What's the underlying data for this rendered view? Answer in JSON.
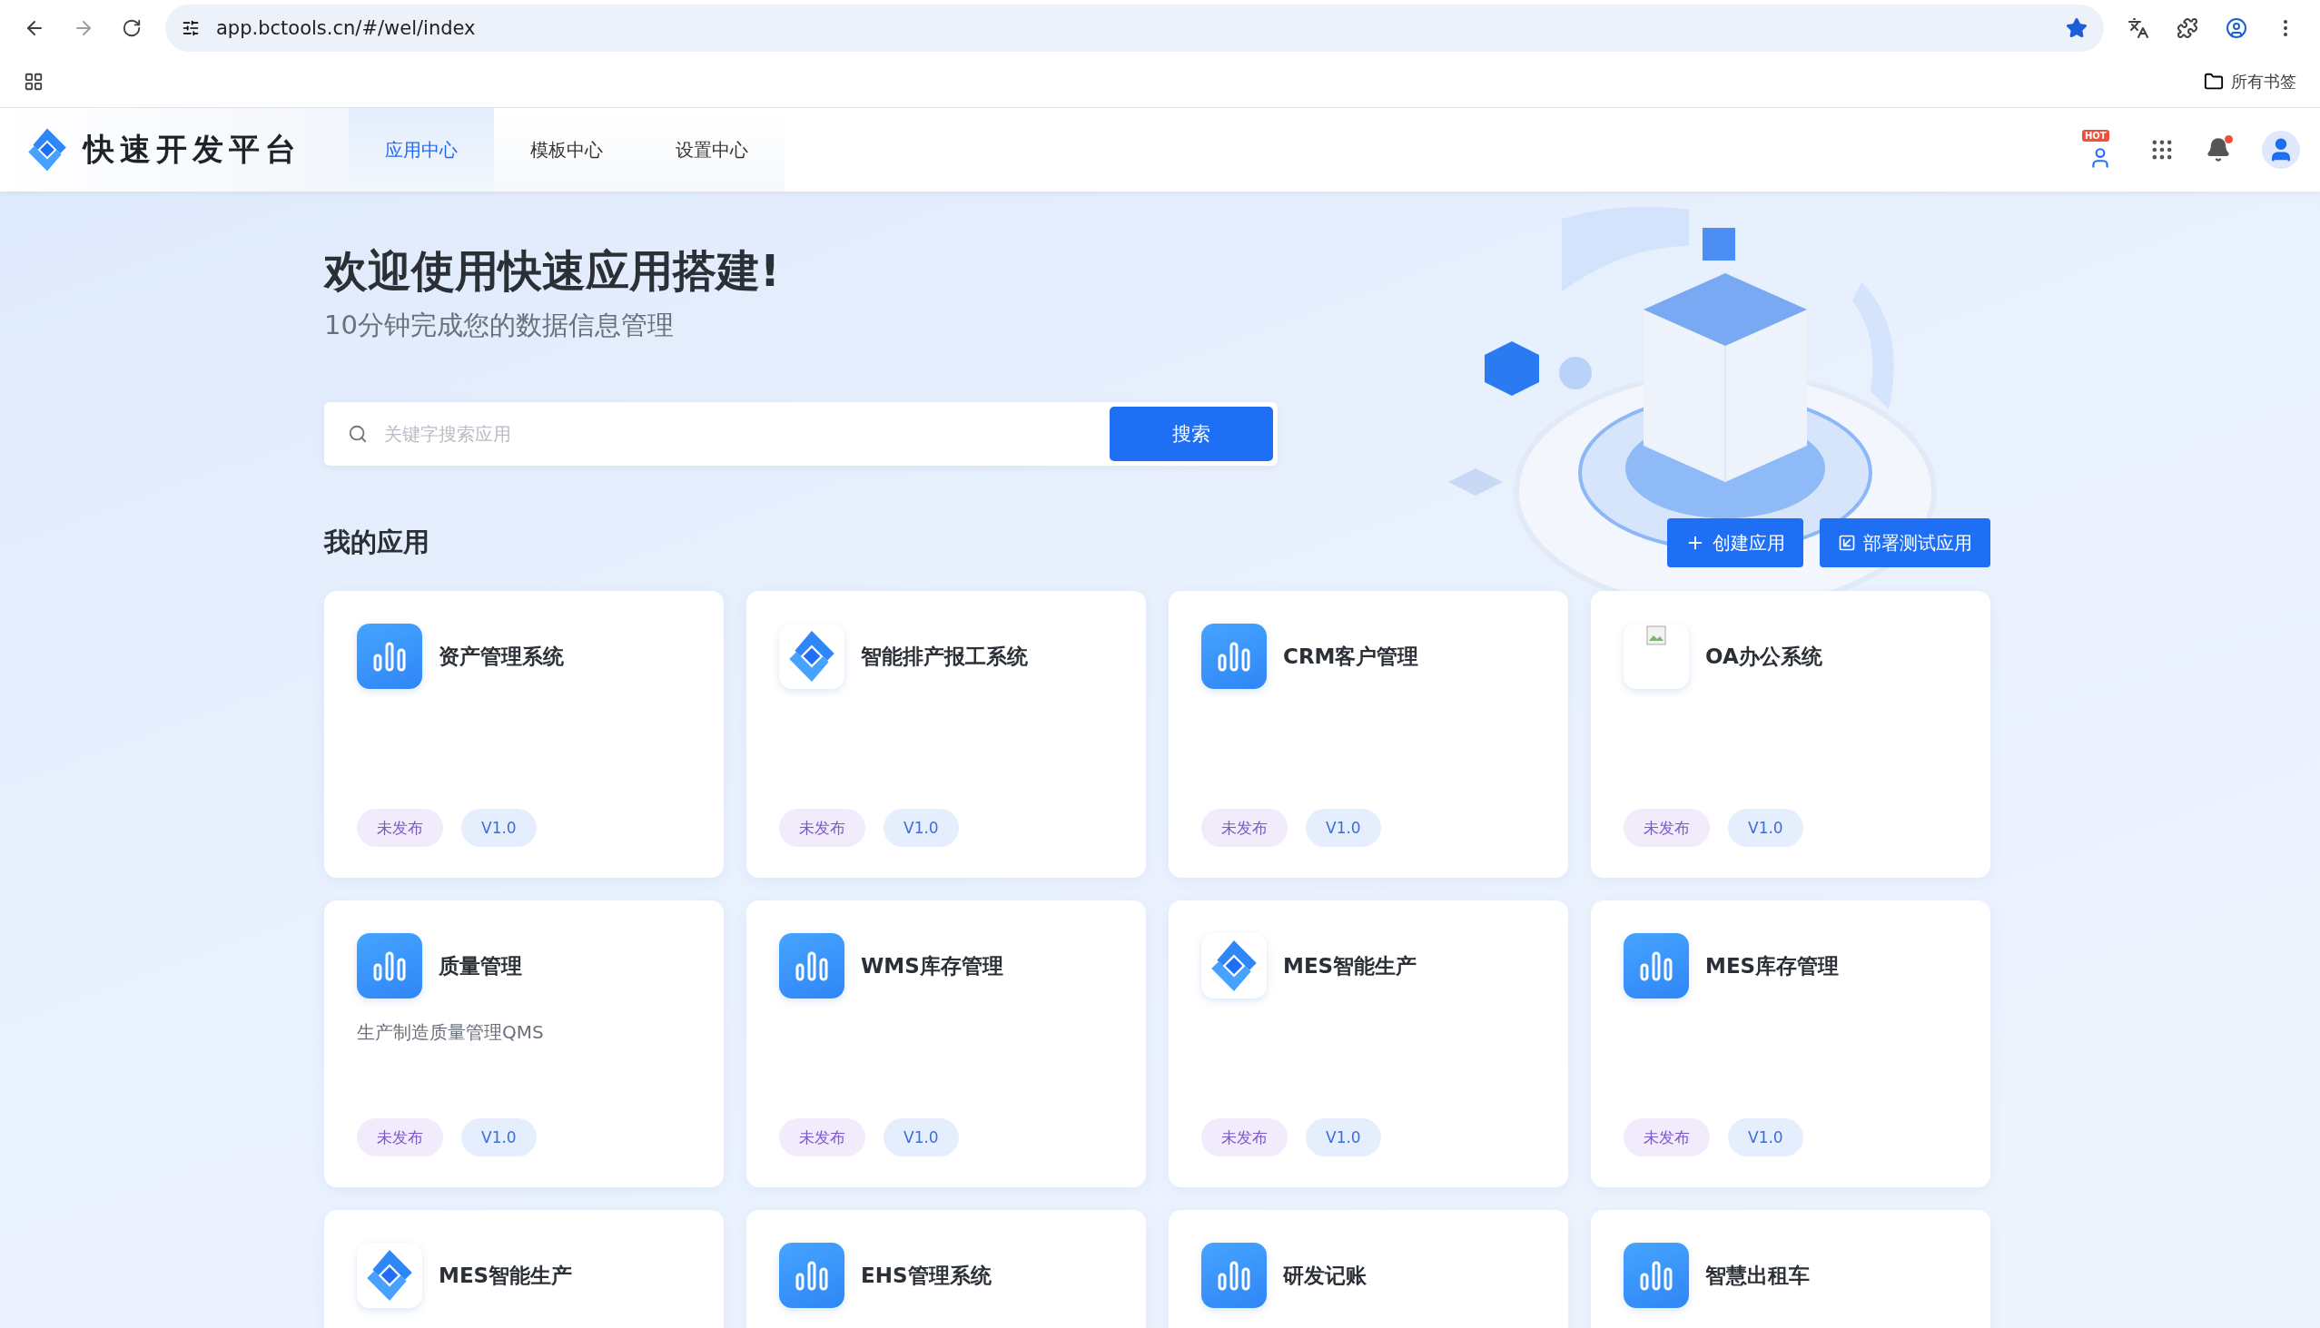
{
  "browser": {
    "url": "app.bctools.cn/#/wel/index",
    "bookmarks_label": "所有书签"
  },
  "header": {
    "brand": "快速开发平台",
    "hot_badge": "HOT",
    "tabs": [
      {
        "label": "应用中心",
        "selected": true
      },
      {
        "label": "模板中心",
        "selected": false
      },
      {
        "label": "设置中心",
        "selected": false
      }
    ]
  },
  "hero": {
    "title": "欢迎使用快速应用搭建!",
    "subtitle": "10分钟完成您的数据信息管理",
    "search": {
      "placeholder": "关键字搜索应用",
      "button": "搜索"
    }
  },
  "section": {
    "title": "我的应用",
    "actions": [
      {
        "label": "创建应用",
        "kind": "create"
      },
      {
        "label": "部署测试应用",
        "kind": "deploy"
      }
    ]
  },
  "apps": [
    {
      "name": "资产管理系统",
      "kind": "bars",
      "status": "未发布",
      "version": "V1.0"
    },
    {
      "name": "智能排产报工系统",
      "kind": "logo",
      "status": "未发布",
      "version": "V1.0"
    },
    {
      "name": "CRM客户管理",
      "kind": "bars",
      "status": "未发布",
      "version": "V1.0"
    },
    {
      "name": "OA办公系统",
      "kind": "broken",
      "status": "未发布",
      "version": "V1.0"
    },
    {
      "name": "质量管理",
      "kind": "bars",
      "description": "生产制造质量管理QMS",
      "status": "未发布",
      "version": "V1.0"
    },
    {
      "name": "WMS库存管理",
      "kind": "bars",
      "status": "未发布",
      "version": "V1.0"
    },
    {
      "name": "MES智能生产",
      "kind": "logo",
      "status": "未发布",
      "version": "V1.0"
    },
    {
      "name": "MES库存管理",
      "kind": "bars",
      "status": "未发布",
      "version": "V1.0"
    },
    {
      "name": "MES智能生产",
      "kind": "logo"
    },
    {
      "name": "EHS管理系统",
      "kind": "bars"
    },
    {
      "name": "研发记账",
      "kind": "bars"
    },
    {
      "name": "智慧出租车",
      "kind": "bars"
    }
  ]
}
